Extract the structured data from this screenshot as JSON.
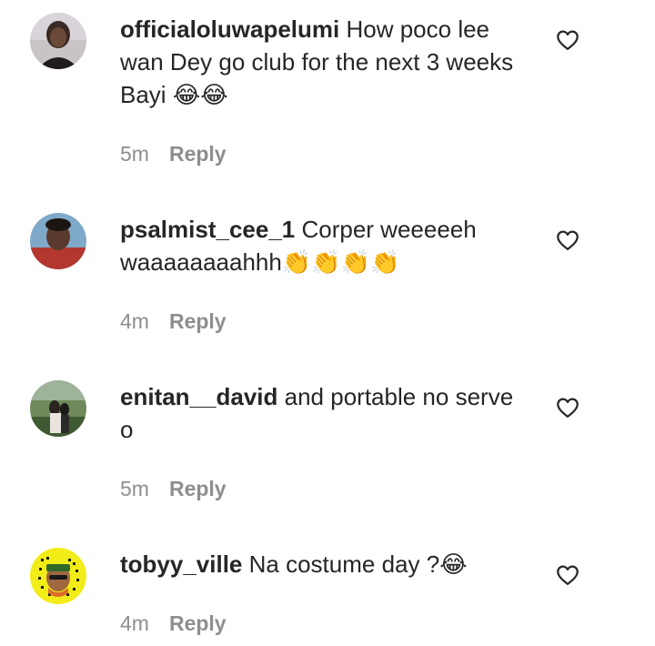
{
  "comments": [
    {
      "username": "officialoluwapelumi",
      "text": "How poco lee wan Dey go club for the next 3 weeks Bayi",
      "emoji": "😂😂",
      "time": "5m",
      "reply_label": "Reply",
      "avatar_icon": "avatar-photo"
    },
    {
      "username": "psalmist_cee_1",
      "text": "Corper weeeeeh waaaaaaaahhh",
      "emoji": "👏👏👏👏",
      "time": "4m",
      "reply_label": "Reply",
      "avatar_icon": "avatar-photo"
    },
    {
      "username": "enitan__david",
      "text": "and portable no serve o",
      "emoji": "",
      "time": "5m",
      "reply_label": "Reply",
      "avatar_icon": "avatar-photo"
    },
    {
      "username": "tobyy_ville",
      "text": "Na costume day ?",
      "emoji": "😂",
      "time": "4m",
      "reply_label": "Reply",
      "avatar_icon": "avatar-photo"
    }
  ],
  "icons": {
    "like": "heart-outline-icon"
  },
  "colors": {
    "text": "#262626",
    "secondary": "#8e8e8e",
    "background": "#ffffff"
  }
}
